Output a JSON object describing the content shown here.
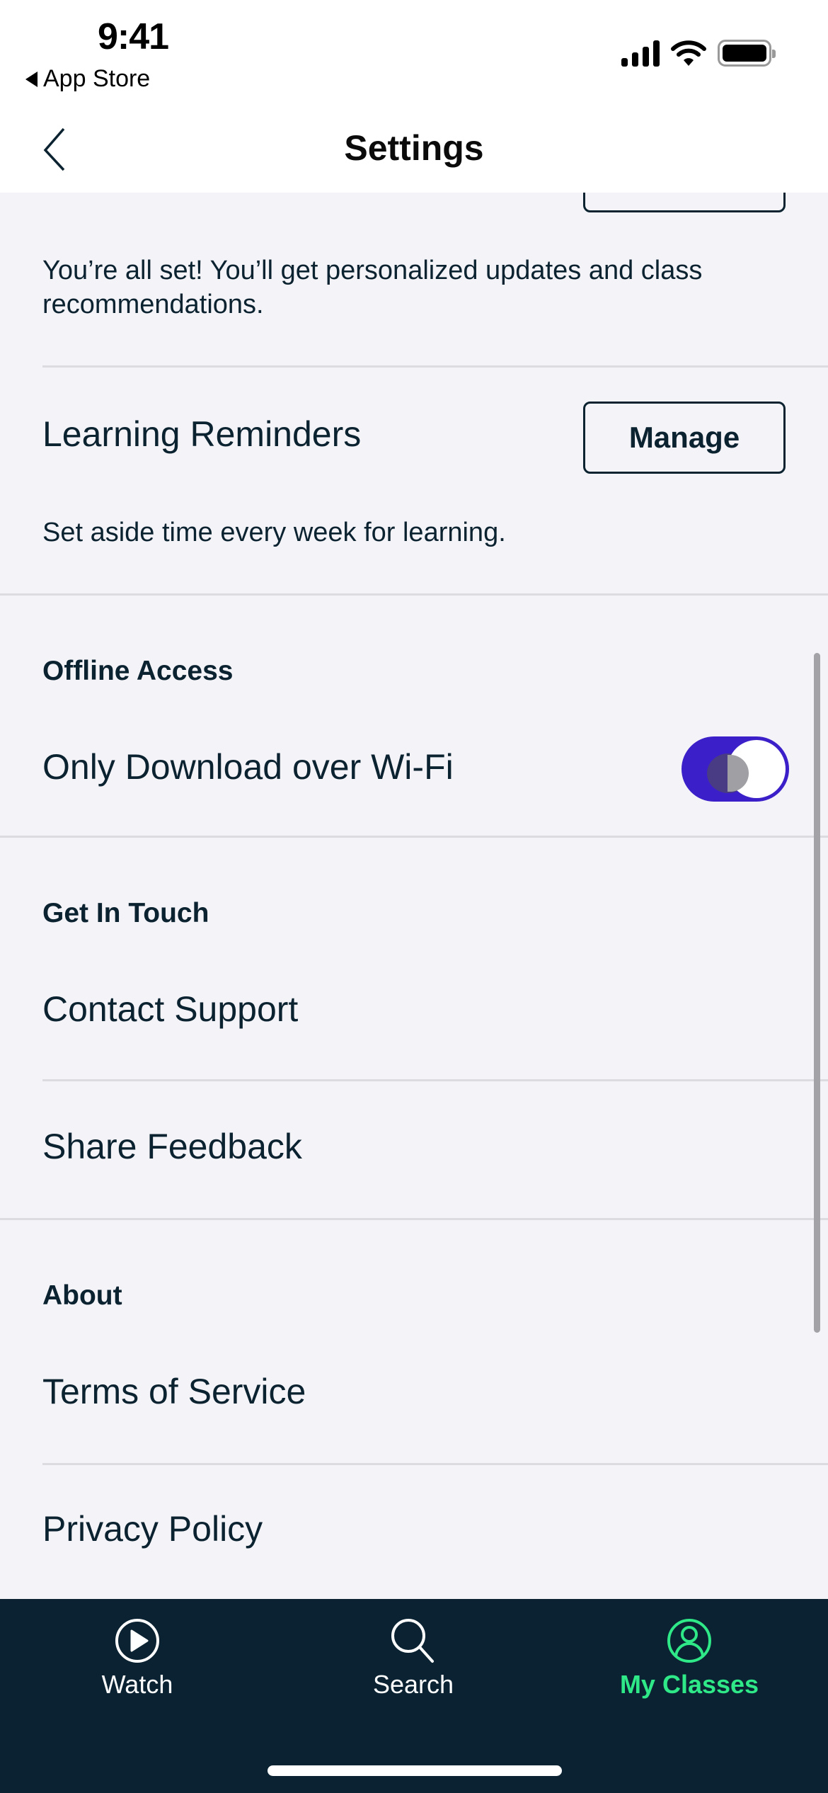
{
  "status_bar": {
    "time": "9:41",
    "back_app_label": "App Store"
  },
  "nav": {
    "title": "Settings",
    "back_icon": "chevron-left-icon"
  },
  "settings": {
    "notifications_description": "You’re all set! You’ll get personalized updates and class recommendations.",
    "learning_reminders": {
      "label": "Learning Reminders",
      "button_label": "Manage",
      "description": "Set aside time every week for learning."
    },
    "offline_access": {
      "header": "Offline Access",
      "wifi_only_label": "Only Download over Wi-Fi",
      "wifi_only_enabled": true
    },
    "get_in_touch": {
      "header": "Get In Touch",
      "items": [
        {
          "label": "Contact Support"
        },
        {
          "label": "Share Feedback"
        }
      ]
    },
    "about": {
      "header": "About",
      "items": [
        {
          "label": "Terms of Service"
        },
        {
          "label": "Privacy Policy"
        }
      ]
    }
  },
  "tab_bar": {
    "tabs": [
      {
        "label": "Watch",
        "icon": "play-circle-icon",
        "active": false
      },
      {
        "label": "Search",
        "icon": "search-icon",
        "active": false
      },
      {
        "label": "My Classes",
        "icon": "user-circle-icon",
        "active": true
      }
    ]
  },
  "colors": {
    "accent": "#3b1fc9",
    "active_tab": "#2fe887",
    "tab_bar_bg": "#0a2231",
    "text": "#0b2230",
    "background": "#f4f3f7"
  }
}
